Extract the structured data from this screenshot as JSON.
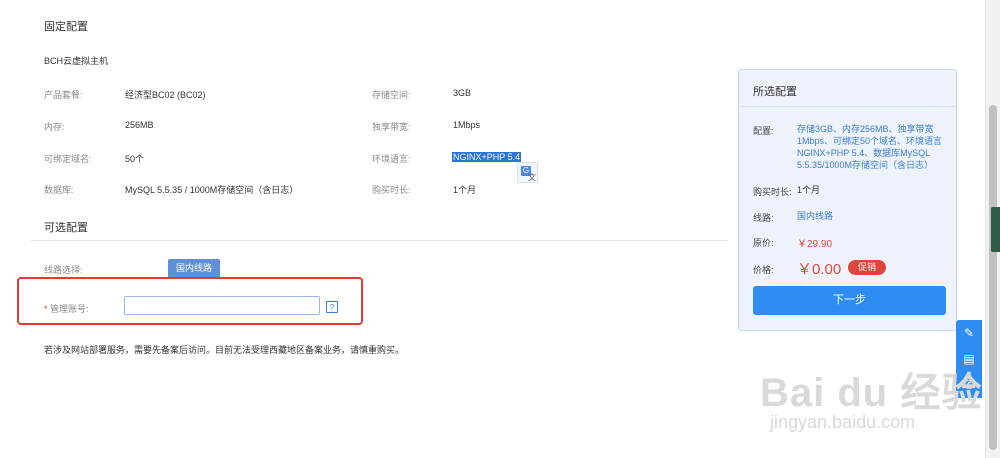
{
  "fixed": {
    "title": "固定配置",
    "product_name": "BCH云虚拟主机",
    "left_rows": [
      {
        "label": "产品套餐:",
        "value": "经济型BC02 (BC02)"
      },
      {
        "label": "内存:",
        "value": "256MB"
      },
      {
        "label": "可绑定域名:",
        "value": "50个"
      },
      {
        "label": "数据库:",
        "value": "MySQL 5.5.35 / 1000M存储空间（含日志）"
      }
    ],
    "right_rows": [
      {
        "label": "存储空间:",
        "value": "3GB"
      },
      {
        "label": "独享带宽:",
        "value": "1Mbps"
      },
      {
        "label": "环境语言:",
        "value": "NGINX+PHP 5.4"
      },
      {
        "label": "购买时长:",
        "value": "1个月"
      }
    ]
  },
  "optional": {
    "title": "可选配置",
    "line_label": "线路选择:",
    "line_option": "国内线路",
    "account_required_mark": "*",
    "account_label": "管理账号:",
    "account_value": "",
    "help_icon": "?",
    "notice": "若涉及网站部署服务，需要先备案后访问。目前无法受理西藏地区备案业务，请慎重购买。"
  },
  "summary": {
    "title": "所选配置",
    "config_label": "配置:",
    "config_lines": [
      "存储3GB、内存256MB、独享带宽",
      "1Mbps、可绑定50个域名、环境语言",
      "NGINX+PHP 5.4、数据库MySQL",
      "5.5.35/1000M存储空间（含日志）"
    ],
    "duration_label": "购买时长:",
    "duration_value": "1个月",
    "line_label": "线路:",
    "line_value": "国内线路",
    "orig_price_label": "原价:",
    "orig_price_value": "￥29.90",
    "price_label": "价格:",
    "price_value": "￥0.00",
    "promo_badge": "促销",
    "next_button": "下一步"
  },
  "icons": {
    "translate": "translate-icon",
    "float": [
      "edit-icon",
      "feedback-icon",
      "phone-icon"
    ]
  },
  "watermark": {
    "main": "Bai du 经验",
    "sub": "jingyan.baidu.com"
  },
  "colors": {
    "accent": "#2f8cf0",
    "price": "#e5483b",
    "panel_bg": "#eef3fb",
    "highlight_box": "#e53935"
  }
}
